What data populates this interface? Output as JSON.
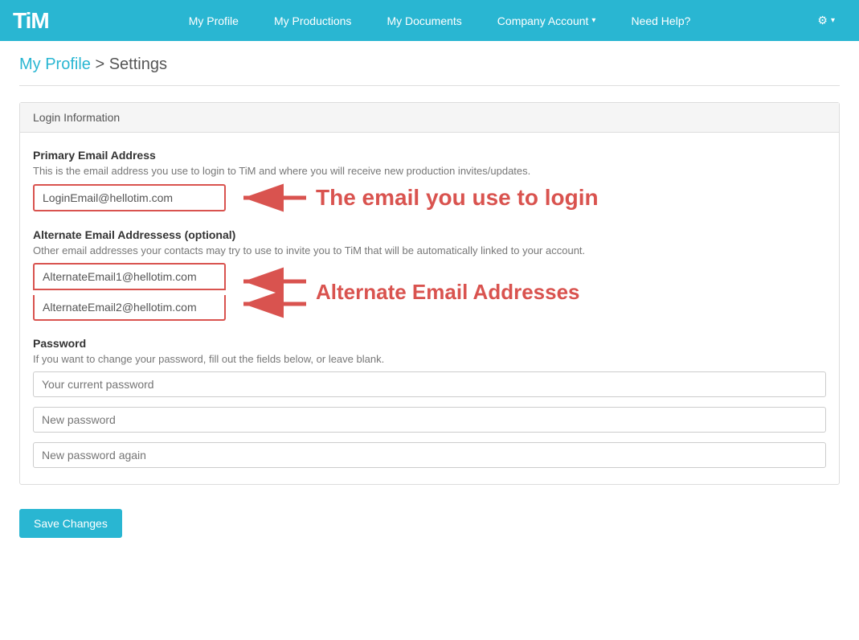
{
  "brand": {
    "name": "TiM"
  },
  "nav": {
    "items": [
      {
        "label": "My Profile",
        "id": "my-profile"
      },
      {
        "label": "My Productions",
        "id": "my-productions"
      },
      {
        "label": "My Documents",
        "id": "my-documents"
      },
      {
        "label": "Company Account",
        "id": "company-account",
        "dropdown": true
      },
      {
        "label": "Need Help?",
        "id": "need-help"
      }
    ],
    "gear_label": "⚙",
    "gear_arrow": "▾"
  },
  "breadcrumb": {
    "parent": "My Profile",
    "separator": " > ",
    "current": "Settings",
    "full": "My Profile Settings"
  },
  "section": {
    "header": "Login Information",
    "primary_email": {
      "label": "Primary Email Address",
      "description": "This is the email address you use to login to TiM and where you will receive new production invites/updates.",
      "value": "LoginEmail@hellotim.com",
      "annotation": "The email you use to login"
    },
    "alternate_email": {
      "label": "Alternate Email Addressess (optional)",
      "description": "Other email addresses your contacts may try to use to invite you to TiM that will be automatically linked to your account.",
      "value1": "AlternateEmail1@hellotim.com",
      "value2": "AlternateEmail2@hellotim.com",
      "annotation": "Alternate Email Addresses"
    },
    "password": {
      "label": "Password",
      "description": "If you want to change your password, fill out the fields below, or leave blank.",
      "current_placeholder": "Your current password",
      "new_placeholder": "New password",
      "confirm_placeholder": "New password again"
    }
  },
  "save_button": "Save Changes"
}
